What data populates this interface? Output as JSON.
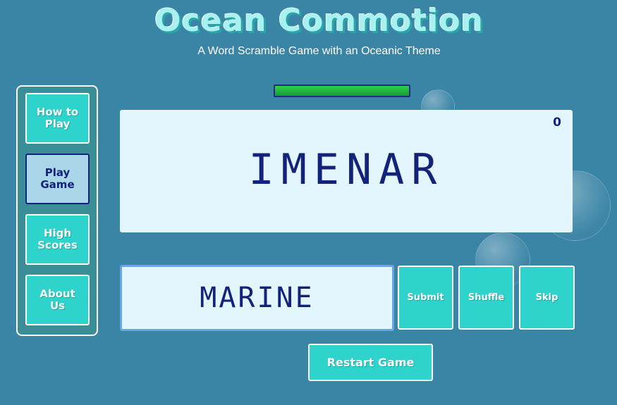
{
  "header": {
    "title": "Ocean Commotion",
    "subtitle": "A Word Scramble Game with an Oceanic Theme"
  },
  "sidebar": {
    "items": [
      {
        "label": "How to Play",
        "icon": "none",
        "active": false
      },
      {
        "label": "Play Game",
        "icon": "none",
        "active": true
      },
      {
        "label": "High Scores",
        "icon": "none",
        "active": false
      },
      {
        "label": "About Us",
        "icon": "none",
        "active": false
      }
    ]
  },
  "game": {
    "timer_fraction": 1.0,
    "score": "0",
    "scrambled_word": "IMENAR",
    "answer_value": "MARINE",
    "answer_placeholder": ""
  },
  "actions": {
    "submit_label": "Submit",
    "shuffle_label": "Shuffle",
    "skip_label": "Skip",
    "restart_label": "Restart Game"
  },
  "colors": {
    "background": "#3a84a5",
    "accent": "#2ed3cb",
    "panel": "#e4f6fd",
    "text_dark": "#14237a",
    "timer_green": "#2fcf4f"
  }
}
